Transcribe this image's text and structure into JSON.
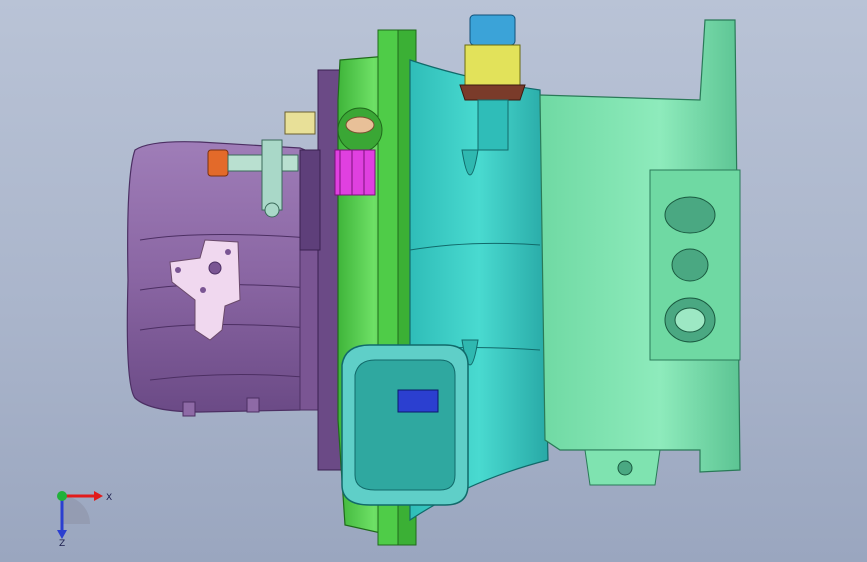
{
  "viewport": {
    "background_top": "#b9c3d6",
    "background_bottom": "#9aa6bf"
  },
  "model": {
    "colors": {
      "intake_purple": "#8e6aa6",
      "intake_purple_dark": "#5e3f7a",
      "gearbox_green": "#5fd35a",
      "gearbox_green_dark": "#2f8f2a",
      "compressor_cyan": "#3ed1c8",
      "compressor_cyan_dark": "#1d8f92",
      "turbine_mint": "#7fe3b0",
      "turbine_mint_dark": "#3a9f78",
      "bracket_pink": "#f0d8ef",
      "magenta_part": "#e040e0",
      "orange_fitting": "#e36a2a",
      "blue_block": "#2b3fd0",
      "top_cap_blue": "#3ba3d8",
      "top_cap_yellow": "#e2e25a",
      "flange_brown": "#7a3b2a"
    }
  },
  "triad": {
    "x_label": "X",
    "z_label": "Z",
    "x_color": "#e21b1b",
    "y_color": "#21b13a",
    "z_color": "#2b3fd0"
  }
}
